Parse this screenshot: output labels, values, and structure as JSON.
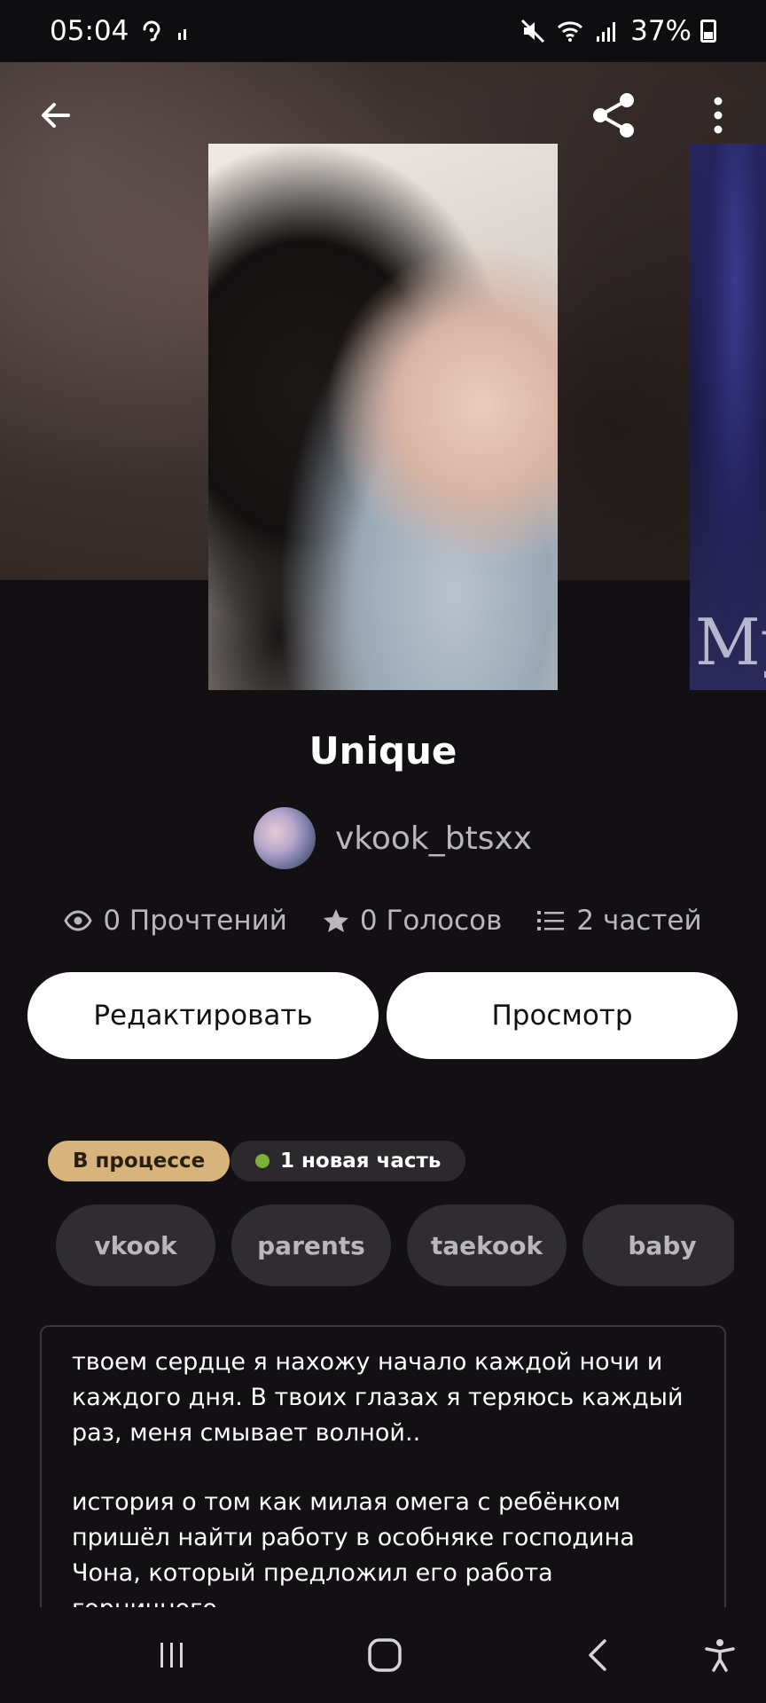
{
  "status_bar": {
    "time": "05:04",
    "battery": "37%",
    "icons": [
      "hearing-icon",
      "signal-small-icon",
      "mute-icon",
      "wifi-icon",
      "signal-icon",
      "battery-icon"
    ]
  },
  "toolbar": {
    "back_icon": "arrow-left-icon",
    "share_icon": "share-icon",
    "more_icon": "more-vertical-icon"
  },
  "story": {
    "title": "Unique",
    "author": "vkook_btsxx",
    "next_cover_text": "My"
  },
  "stats": {
    "reads": "0 Прочтений",
    "votes": "0 Голосов",
    "parts": "2 частей"
  },
  "actions": {
    "edit_label": "Редактировать",
    "preview_label": "Просмотр"
  },
  "badges": {
    "status": "В процессе",
    "new_parts": "1 новая часть"
  },
  "tags": [
    "vkook",
    "parents",
    "taekook",
    "baby"
  ],
  "description": {
    "paragraph1": "твоем сердце я нахожу начало каждой ночи и каждого дня. В твоих глазах я теряюсь каждый раз, меня смывает волной..",
    "paragraph2": "история о том как милая омега с ребёнком пришёл найти работу в особняке господина Чона, который предложил его работа горничного"
  },
  "colors": {
    "background": "#121013",
    "status_badge": "#d6b47c",
    "new_dot": "#79b03a",
    "tag_bg": "#2f2d31"
  }
}
